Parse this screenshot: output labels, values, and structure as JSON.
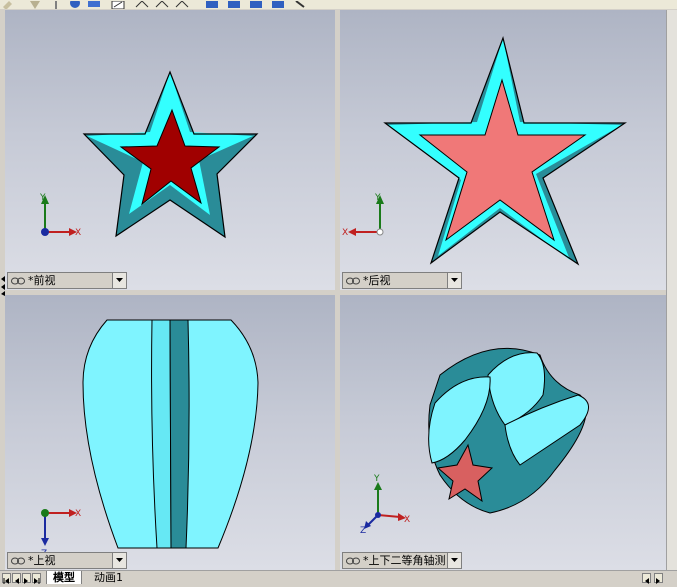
{
  "viewports": {
    "front": {
      "label": "*前视",
      "axes": {
        "x": "X",
        "y": "Y"
      }
    },
    "back": {
      "label": "*后视",
      "axes": {
        "x": "X",
        "y": "Y"
      }
    },
    "top": {
      "label": "*上视",
      "axes": {
        "x": "X",
        "z": "Z"
      }
    },
    "iso": {
      "label": "*上下二等角轴测",
      "axes": {
        "x": "X",
        "y": "Y",
        "z": "Z"
      }
    }
  },
  "tabs": [
    {
      "label": "模型",
      "active": true
    },
    {
      "label": "动画1",
      "active": false
    }
  ],
  "colors": {
    "star_face_front": "#a00000",
    "star_face_back": "#f07878",
    "star_bevel": "#33ffff",
    "star_side": "#2a8c98",
    "viewport_bg": "#c2c6d2"
  }
}
